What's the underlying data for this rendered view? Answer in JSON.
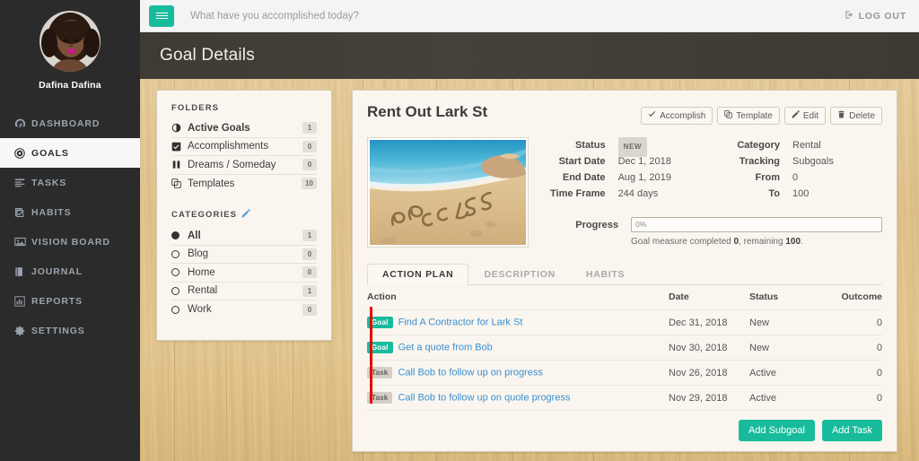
{
  "colors": {
    "accent": "#18bc9c",
    "sidebar_bg": "#2b2b2b",
    "pagehead_bg": "#413c35",
    "desk_wood": "#e3c58e",
    "card_bg": "#faf6ef",
    "link": "#3b8fd0",
    "alert_bar": "#e60000"
  },
  "sidebar": {
    "profile_name": "Dafina Dafina",
    "avatar_icon": "user-avatar-photo",
    "items": [
      {
        "label": "DASHBOARD",
        "icon": "dashboard-icon",
        "active": false
      },
      {
        "label": "GOALS",
        "icon": "bullseye-icon",
        "active": true
      },
      {
        "label": "TASKS",
        "icon": "list-icon",
        "active": false
      },
      {
        "label": "HABITS",
        "icon": "check-square-icon",
        "active": false
      },
      {
        "label": "VISION BOARD",
        "icon": "picture-icon",
        "active": false
      },
      {
        "label": "JOURNAL",
        "icon": "book-icon",
        "active": false
      },
      {
        "label": "REPORTS",
        "icon": "bar-chart-icon",
        "active": false
      },
      {
        "label": "SETTINGS",
        "icon": "gear-icon",
        "active": false
      }
    ]
  },
  "topbar": {
    "menu_icon": "hamburger-icon",
    "prompt": "What have you accomplished today?",
    "logout_label": "LOG OUT",
    "logout_icon": "sign-out-icon"
  },
  "pagehead": {
    "title": "Goal Details"
  },
  "folders_panel": {
    "folders_label": "FOLDERS",
    "folders": [
      {
        "label": "Active Goals",
        "count": "1",
        "icon": "adjust-circle-icon",
        "selected": true
      },
      {
        "label": "Accomplishments",
        "count": "0",
        "icon": "check-square-icon",
        "selected": false
      },
      {
        "label": "Dreams / Someday",
        "count": "0",
        "icon": "pause-icon",
        "selected": false
      },
      {
        "label": "Templates",
        "count": "10",
        "icon": "clone-icon",
        "selected": false
      }
    ],
    "categories_label": "CATEGORIES",
    "categories_edit_icon": "edit-pencil-icon",
    "categories": [
      {
        "label": "All",
        "count": "1",
        "selected": true
      },
      {
        "label": "Blog",
        "count": "0",
        "selected": false
      },
      {
        "label": "Home",
        "count": "0",
        "selected": false
      },
      {
        "label": "Rental",
        "count": "1",
        "selected": false
      },
      {
        "label": "Work",
        "count": "0",
        "selected": false
      }
    ]
  },
  "goal": {
    "title": "Rent Out Lark St",
    "image_alt": "beach-success-photo",
    "actions": [
      {
        "label": "Accomplish",
        "icon": "check-icon"
      },
      {
        "label": "Template",
        "icon": "clone-icon"
      },
      {
        "label": "Edit",
        "icon": "pencil-icon"
      },
      {
        "label": "Delete",
        "icon": "trash-icon"
      }
    ],
    "fields_left": [
      {
        "label": "Status",
        "value": "NEW",
        "is_chip": true
      },
      {
        "label": "Start Date",
        "value": "Dec 1, 2018"
      },
      {
        "label": "End Date",
        "value": "Aug 1, 2019"
      },
      {
        "label": "Time Frame",
        "value": "244 days"
      }
    ],
    "fields_right": [
      {
        "label": "Category",
        "value": "Rental"
      },
      {
        "label": "Tracking",
        "value": "Subgoals"
      },
      {
        "label": "From",
        "value": "0"
      },
      {
        "label": "To",
        "value": "100"
      }
    ],
    "progress": {
      "label": "Progress",
      "percent_text": "0%",
      "percent_value": 0,
      "note_prefix": "Goal measure completed ",
      "note_completed": "0",
      "note_mid": ", remaining ",
      "note_remaining": "100",
      "note_suffix": "."
    }
  },
  "tabs": [
    {
      "label": "ACTION PLAN",
      "active": true
    },
    {
      "label": "DESCRIPTION",
      "active": false
    },
    {
      "label": "HABITS",
      "active": false
    }
  ],
  "plan_table": {
    "headers": {
      "action": "Action",
      "date": "Date",
      "status": "Status",
      "outcome": "Outcome"
    },
    "rows": [
      {
        "tag": "Goal",
        "tag_type": "goal",
        "indent": 1,
        "action": "Find A Contractor for Lark St",
        "date": "Dec 31, 2018",
        "status": "New",
        "outcome": "0"
      },
      {
        "tag": "Goal",
        "tag_type": "goal",
        "indent": 2,
        "action": "Get a quote from Bob",
        "date": "Nov 30, 2018",
        "status": "New",
        "outcome": "0"
      },
      {
        "tag": "Task",
        "tag_type": "task",
        "indent": 3,
        "action": "Call Bob to follow up on progress",
        "date": "Nov 26, 2018",
        "status": "Active",
        "outcome": "0"
      },
      {
        "tag": "Task",
        "tag_type": "task",
        "indent": 3,
        "action": "Call Bob to follow up on quote progress",
        "date": "Nov 29, 2018",
        "status": "Active",
        "outcome": "0"
      }
    ]
  },
  "footer_buttons": [
    {
      "label": "Add Subgoal"
    },
    {
      "label": "Add Task"
    }
  ]
}
